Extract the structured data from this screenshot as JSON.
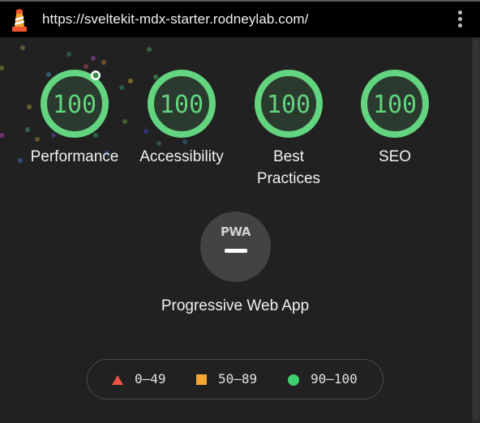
{
  "address_bar": {
    "url": "https://sveltekit-mdx-starter.rodneylab.com/",
    "logo_icon": "lighthouse-icon",
    "menu_icon": "more-vertical-icon"
  },
  "categories": [
    {
      "score": "100",
      "label": "Performance"
    },
    {
      "score": "100",
      "label": "Accessibility"
    },
    {
      "score": "100",
      "label": "Best Practices"
    },
    {
      "score": "100",
      "label": "SEO"
    }
  ],
  "pwa": {
    "badge_text": "PWA",
    "label": "Progressive Web App"
  },
  "legend": [
    {
      "range": "0–49",
      "shape": "triangle",
      "color": "#ec5448"
    },
    {
      "range": "50–89",
      "shape": "square",
      "color": "#f4a534"
    },
    {
      "range": "90–100",
      "shape": "circle",
      "color": "#3fcf6d"
    }
  ],
  "colors": {
    "pass": "#63d47f",
    "background": "#212121",
    "bar": "#000000"
  }
}
